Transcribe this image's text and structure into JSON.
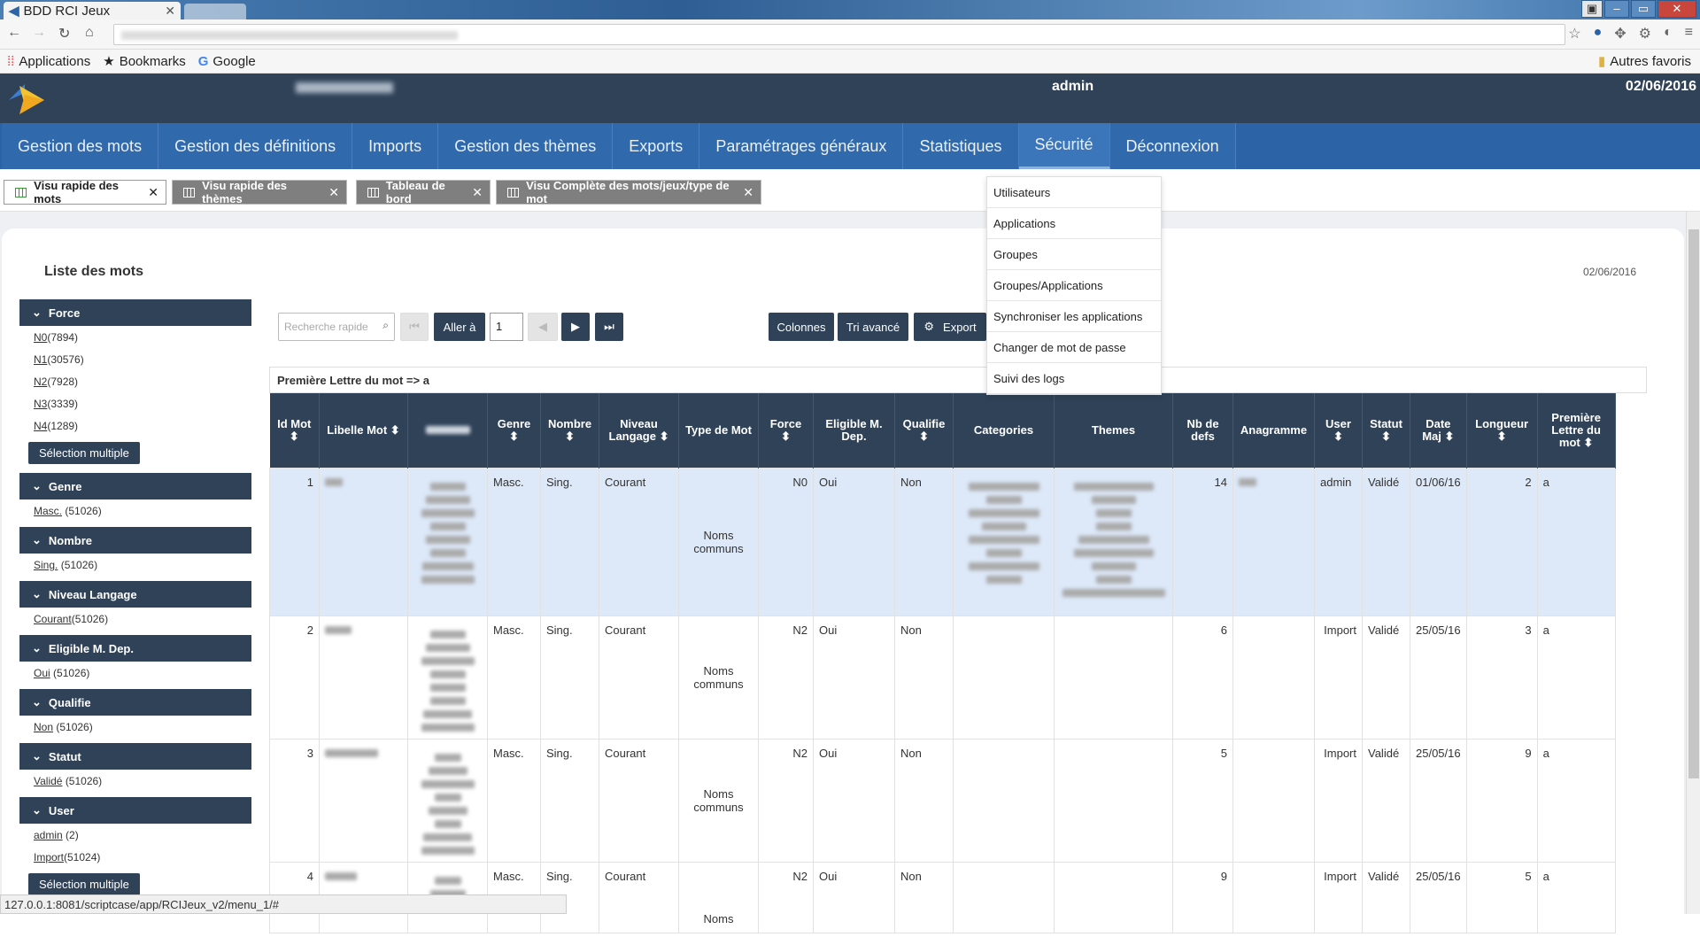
{
  "browser": {
    "tab_title": "BDD RCI Jeux",
    "bookmarks": [
      "Applications",
      "Bookmarks",
      "Google"
    ],
    "other_bookmarks": "Autres favoris",
    "status_url": "127.0.0.1:8081/scriptcase/app/RCIJeux_v2/menu_1/#"
  },
  "header": {
    "user": "admin",
    "date": "02/06/2016"
  },
  "menu": [
    "Gestion des mots",
    "Gestion des définitions",
    "Imports",
    "Gestion des thèmes",
    "Exports",
    "Paramétrages généraux",
    "Statistiques",
    "Sécurité",
    "Déconnexion"
  ],
  "security_menu": [
    "Utilisateurs",
    "Applications",
    "Groupes",
    "Groupes/Applications",
    "Synchroniser les applications",
    "Changer de mot de passe",
    "Suivi des logs"
  ],
  "page_tabs": [
    "Visu rapide des mots",
    "Visu rapide des thèmes",
    "Tableau de bord",
    "Visu Complète des mots/jeux/type de mot"
  ],
  "list_title": "Liste des mots",
  "list_date": "02/06/2016",
  "filters": {
    "force_title": "Force",
    "force_items": [
      {
        "label": "N0",
        "count": "(7894)"
      },
      {
        "label": "N1",
        "count": "(30576)"
      },
      {
        "label": "N2",
        "count": "(7928)"
      },
      {
        "label": "N3",
        "count": "(3339)"
      },
      {
        "label": "N4",
        "count": "(1289)"
      }
    ],
    "multi_btn": "Sélection multiple",
    "genre_title": "Genre",
    "genre_item": "Masc.",
    "genre_count": "(51026)",
    "nombre_title": "Nombre",
    "nombre_item": "Sing.",
    "nombre_count": "(51026)",
    "niveau_title": "Niveau Langage",
    "niveau_item": "Courant",
    "niveau_count": "(51026)",
    "eligible_title": "Eligible M. Dep.",
    "eligible_item": "Oui",
    "eligible_count": "(51026)",
    "qualifie_title": "Qualifie",
    "qualifie_item": "Non",
    "qualifie_count": "(51026)",
    "statut_title": "Statut",
    "statut_item": "Validé",
    "statut_count": "(51026)",
    "user_title": "User",
    "user_items": [
      {
        "label": "admin",
        "count": "(2)"
      },
      {
        "label": "Import",
        "count": "(51024)"
      }
    ]
  },
  "toolbar": {
    "search_placeholder": "Recherche rapide",
    "goto": "Aller à",
    "page": "1",
    "columns": "Colonnes",
    "sort": "Tri avancé",
    "export": "Export"
  },
  "group_label": "Première Lettre du mot => a",
  "columns": [
    "Id Mot",
    "Libelle Mot",
    "Jeux Eligibles",
    "Genre",
    "Nombre",
    "Niveau Langage",
    "Type de Mot",
    "Force",
    "Eligible M. Dep.",
    "Qualifie",
    "Categories",
    "Themes",
    "Nb de defs",
    "Anagramme",
    "User",
    "Statut",
    "Date Maj",
    "Longueur",
    "Première Lettre du mot"
  ],
  "rows": [
    {
      "id": "1",
      "genre": "Masc.",
      "nombre": "Sing.",
      "niveau": "Courant",
      "type": "Noms communs",
      "force": "N0",
      "elig": "Oui",
      "qual": "Non",
      "nbdefs": "14",
      "user": "admin",
      "statut": "Validé",
      "date": "01/06/16",
      "len": "2",
      "first": "a"
    },
    {
      "id": "2",
      "genre": "Masc.",
      "nombre": "Sing.",
      "niveau": "Courant",
      "type": "Noms communs",
      "force": "N2",
      "elig": "Oui",
      "qual": "Non",
      "nbdefs": "6",
      "user": "Import",
      "statut": "Validé",
      "date": "25/05/16",
      "len": "3",
      "first": "a"
    },
    {
      "id": "3",
      "genre": "Masc.",
      "nombre": "Sing.",
      "niveau": "Courant",
      "type": "Noms communs",
      "force": "N2",
      "elig": "Oui",
      "qual": "Non",
      "nbdefs": "5",
      "user": "Import",
      "statut": "Validé",
      "date": "25/05/16",
      "len": "9",
      "first": "a"
    },
    {
      "id": "4",
      "genre": "Masc.",
      "nombre": "Sing.",
      "niveau": "Courant",
      "type": "Noms",
      "force": "N2",
      "elig": "Oui",
      "qual": "Non",
      "nbdefs": "9",
      "user": "Import",
      "statut": "Validé",
      "date": "25/05/16",
      "len": "5",
      "first": "a"
    }
  ]
}
